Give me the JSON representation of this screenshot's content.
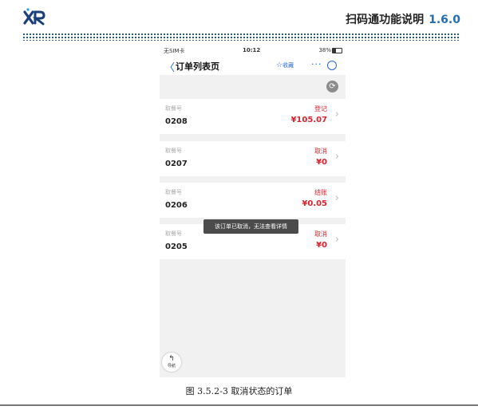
{
  "document": {
    "logo_text": "XR",
    "title": "扫码通功能说明",
    "version": "1.6.0",
    "caption": "图 3.5.2-3  取消状态的订单"
  },
  "phone": {
    "status_bar": {
      "carrier": "无SIM卡",
      "time": "10:12",
      "battery": "38%"
    },
    "nav": {
      "back_glyph": "〈",
      "title": "订单列表页",
      "favorite_label": "收藏",
      "more_glyph": "···"
    },
    "order_label": "取餐号",
    "orders": [
      {
        "number": "0208",
        "status": "登记",
        "amount": "¥105.07"
      },
      {
        "number": "0207",
        "status": "取消",
        "amount": "¥0"
      },
      {
        "number": "0206",
        "status": "结账",
        "amount": "¥0.05"
      },
      {
        "number": "0205",
        "status": "取消",
        "amount": "¥0"
      }
    ],
    "toast": "该订单已取消，无法查看详情",
    "nav_button_label": "导航"
  },
  "colors": {
    "accent": "#2b66d9",
    "status": "#d9232e",
    "brand": "#1e6fb5"
  }
}
